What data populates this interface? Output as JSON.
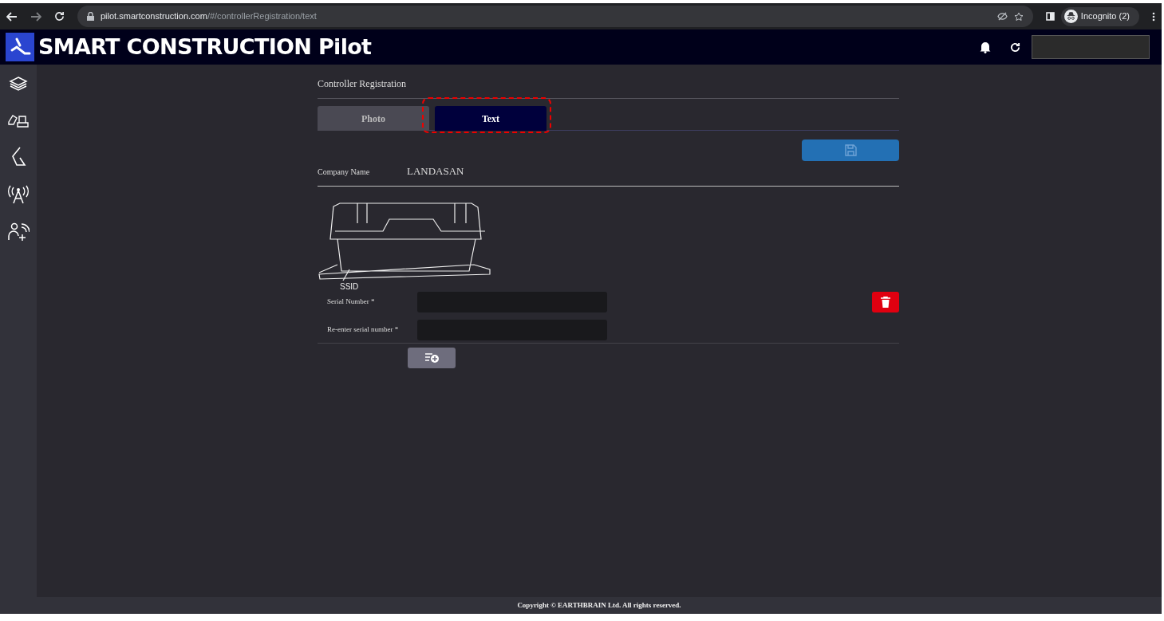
{
  "browser": {
    "url_host": "pilot.smartconstruction.com",
    "url_path": "/#/controllerRegistration/text",
    "profile": "Incognito (2)"
  },
  "app": {
    "title": "SMART CONSTRUCTION Pilot"
  },
  "page": {
    "title": "Controller Registration",
    "tabs": [
      {
        "label": "Photo",
        "selected": false
      },
      {
        "label": "Text",
        "selected": true
      }
    ],
    "company": {
      "label": "Company Name",
      "value": "LANDASAN"
    },
    "diagram_label": "SSID",
    "fields": [
      {
        "label": "Serial Number *"
      },
      {
        "label": "Re-enter serial number *"
      }
    ]
  },
  "footer": "Copyright © EARTHBRAIN Ltd. All rights reserved."
}
